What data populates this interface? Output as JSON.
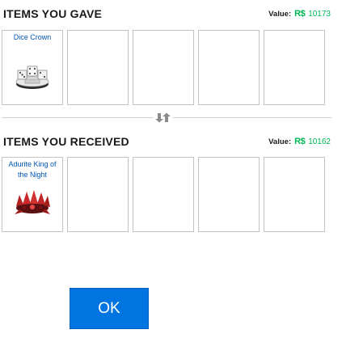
{
  "gave": {
    "title": "ITEMS YOU GAVE",
    "value_label": "Value:",
    "currency_icon": "R$",
    "value": "10173",
    "items": [
      {
        "name": "Dice Crown"
      }
    ]
  },
  "received": {
    "title": "ITEMS YOU RECEIVED",
    "value_label": "Value:",
    "currency_icon": "R$",
    "value": "10162",
    "items": [
      {
        "name": "Adurite King of the Night"
      }
    ]
  },
  "swap_icon": "swap-arrows-icon",
  "ok_button": {
    "label": "OK"
  },
  "colors": {
    "robux_green": "#02b757",
    "item_link": "#0055b3",
    "ok_blue": "#0074e0"
  }
}
